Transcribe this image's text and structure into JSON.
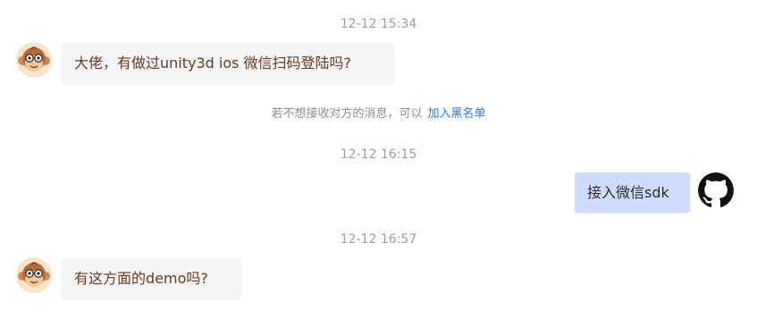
{
  "chat": {
    "messages": [
      {
        "time": "12-12 15:34",
        "side": "left",
        "avatar": "monkey-avatar",
        "text": "大佬，有做过unity3d ios 微信扫码登陆吗?"
      },
      {
        "time": "12-12 16:15",
        "side": "right",
        "avatar": "github-avatar",
        "text": "接入微信sdk"
      },
      {
        "time": "12-12 16:57",
        "side": "left",
        "avatar": "monkey-avatar",
        "text": "有这方面的demo吗?"
      }
    ],
    "notice": {
      "text": "若不想接收对方的消息，可以",
      "link": "加入黑名单"
    }
  },
  "colors": {
    "left_bubble_bg": "#f4f5f7",
    "right_bubble_bg": "#cfdcff",
    "link": "#2f7ad8",
    "timestamp": "#9aa0a6"
  }
}
